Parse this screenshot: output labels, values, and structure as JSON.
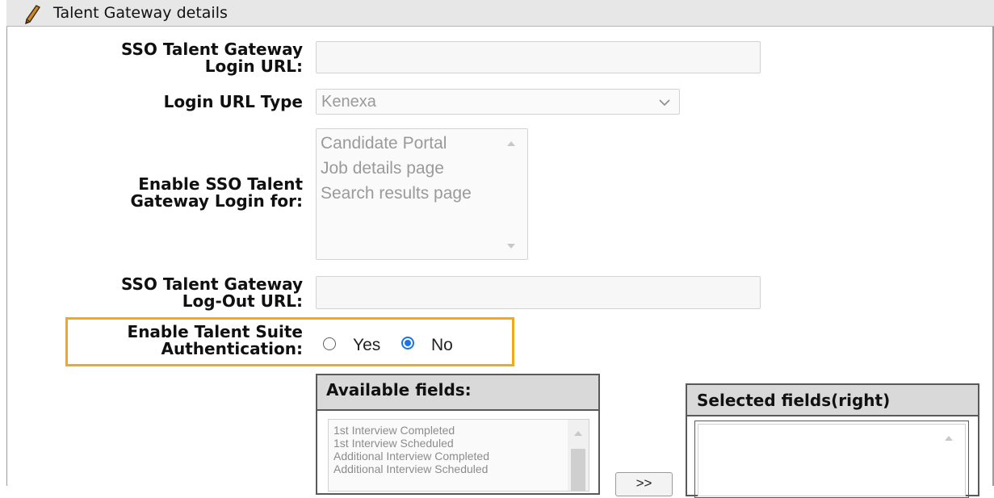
{
  "section": {
    "title": "Talent Gateway details",
    "icon": "pencil-icon"
  },
  "fields": {
    "sso_login_url": {
      "label_line1": "SSO Talent Gateway",
      "label_line2": "Login URL:",
      "value": ""
    },
    "login_url_type": {
      "label": "Login URL Type",
      "selected": "Kenexa"
    },
    "enable_sso_for": {
      "label_line1": "Enable SSO Talent",
      "label_line2": "Gateway Login for:",
      "options": [
        "Candidate Portal",
        "Job details page",
        "Search results page"
      ]
    },
    "sso_logout_url": {
      "label_line1": "SSO Talent Gateway",
      "label_line2": "Log-Out URL:",
      "value": ""
    },
    "talent_suite_auth": {
      "label_line1": "Enable Talent Suite",
      "label_line2": "Authentication:",
      "yes_label": "Yes",
      "no_label": "No",
      "selected": "No"
    }
  },
  "available_fields": {
    "title": "Available fields:",
    "items": [
      "1st Interview Completed",
      "1st Interview Scheduled",
      "Additional Interview Completed",
      "Additional Interview Scheduled"
    ]
  },
  "move_button": {
    "label": ">>"
  },
  "selected_fields": {
    "title": "Selected fields(right)",
    "items": []
  },
  "colors": {
    "highlight": "#f5a81c",
    "radio_selected": "#1a73e8",
    "header_bg": "#e7e7e7"
  }
}
